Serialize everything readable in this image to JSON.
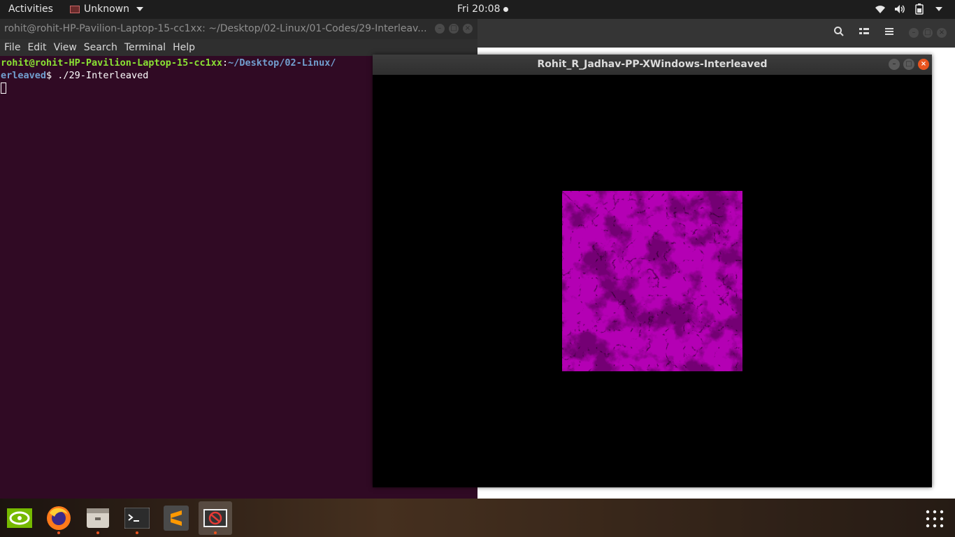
{
  "topbar": {
    "activities": "Activities",
    "app_name": "Unknown",
    "clock": "Fri 20:08"
  },
  "terminal": {
    "title": "rohit@rohit-HP-Pavilion-Laptop-15-cc1xx: ~/Desktop/02-Linux/01-Codes/29-Interleav...",
    "menu": [
      "File",
      "Edit",
      "View",
      "Search",
      "Terminal",
      "Help"
    ],
    "prompt_user": "rohit@rohit-HP-Pavilion-Laptop-15-cc1xx",
    "prompt_sep": ":",
    "prompt_path": "~/Desktop/02-Linux/",
    "prompt_path_cont": "erleaved",
    "prompt_symbol": "$ ",
    "command": "./29-Interleaved"
  },
  "xwindow": {
    "title": "Rohit_R_Jadhav-PP-XWindows-Interleaved"
  },
  "dock": {
    "items": [
      "nvidia-settings-icon",
      "firefox-icon",
      "files-icon",
      "terminal-icon",
      "sublime-text-icon",
      "xwindows-app-icon"
    ]
  },
  "colors": {
    "terminal_bg": "#300a24",
    "prompt_user": "#8ae234",
    "prompt_path": "#729fcf",
    "marble": "#b400b4",
    "close_button": "#e9541e"
  }
}
